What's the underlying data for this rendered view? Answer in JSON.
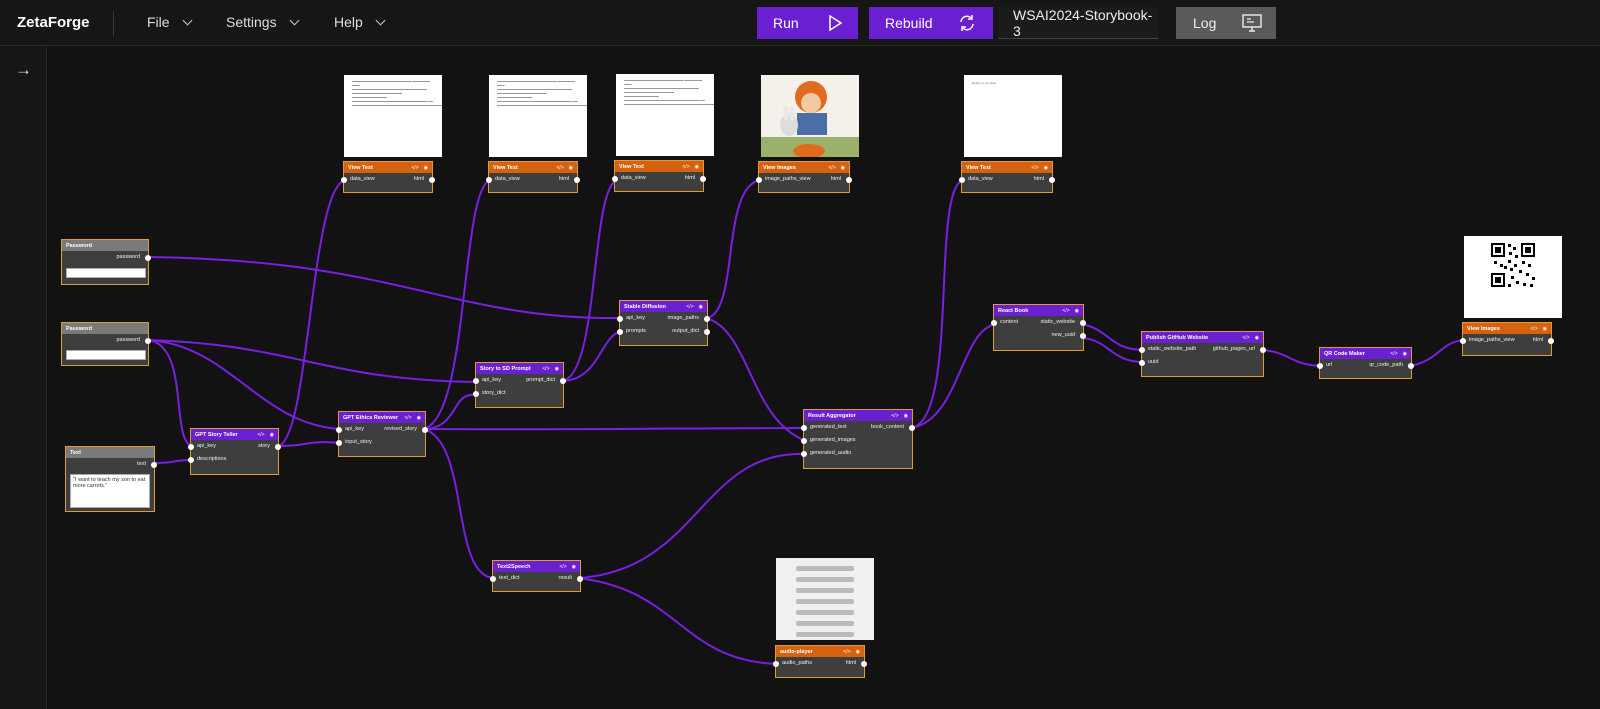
{
  "app": {
    "brand": "ZetaForge"
  },
  "menus": {
    "file": "File",
    "settings": "Settings",
    "help": "Help"
  },
  "toolbar": {
    "run": "Run",
    "rebuild": "Rebuild",
    "project": "WSAI2024-Storybook-3",
    "log": "Log"
  },
  "colors": {
    "accent": "#6a1fd0",
    "orange": "#d4620e",
    "border": "#e39a32",
    "wire": "#7a1ee0"
  },
  "blocks": {
    "pw1": {
      "title": "Password",
      "out": "password"
    },
    "pw2": {
      "title": "Password",
      "out": "password"
    },
    "text": {
      "title": "Text",
      "out": "text",
      "value": "\"I want to teach my son to eat more carrots.\""
    },
    "gpt_teller": {
      "title": "GPT Story Teller",
      "in1": "api_key",
      "in2": "descriptions",
      "out": "story"
    },
    "ethics": {
      "title": "GPT Ethics Reviewer",
      "in1": "api_key",
      "in2": "input_story",
      "out": "revised_story"
    },
    "sdprompt": {
      "title": "Story to SD Prompt",
      "in1": "api_key",
      "in2": "story_dict",
      "out": "prompt_dict"
    },
    "sd": {
      "title": "Stable Diffusion",
      "in1": "api_key",
      "in2": "prompts",
      "out1": "image_paths",
      "out2": "output_dict"
    },
    "vt1": {
      "title": "View Text",
      "in": "data_view",
      "out": "html"
    },
    "vt2": {
      "title": "View Text",
      "in": "data_view",
      "out": "html"
    },
    "vt3": {
      "title": "View Text",
      "in": "data_view",
      "out": "html"
    },
    "vimg": {
      "title": "View Images",
      "in": "image_paths_view",
      "out": "html"
    },
    "vt4": {
      "title": "View Text",
      "in": "data_view",
      "out": "html"
    },
    "aggr": {
      "title": "Result Aggregator",
      "in1": "generated_text",
      "in2": "generated_images",
      "in3": "generated_audio",
      "out": "book_content"
    },
    "react": {
      "title": "React Book",
      "in": "content",
      "out1": "static_website",
      "out2": "new_uuid"
    },
    "publish": {
      "title": "Publish GitHub Website",
      "in1": "static_website_path",
      "in2": "uuid",
      "out": "github_pages_url"
    },
    "qr": {
      "title": "QR Code Maker",
      "in": "url",
      "out": "qr_code_path"
    },
    "vimg2": {
      "title": "View Images",
      "in": "image_paths_view",
      "out": "html"
    },
    "tts": {
      "title": "Text2Speech",
      "in": "text_dict",
      "out": "result"
    },
    "audio": {
      "title": "audio-player",
      "in": "audio_paths",
      "out": "html"
    }
  },
  "previews": {
    "vt4": "Ready to populate"
  }
}
